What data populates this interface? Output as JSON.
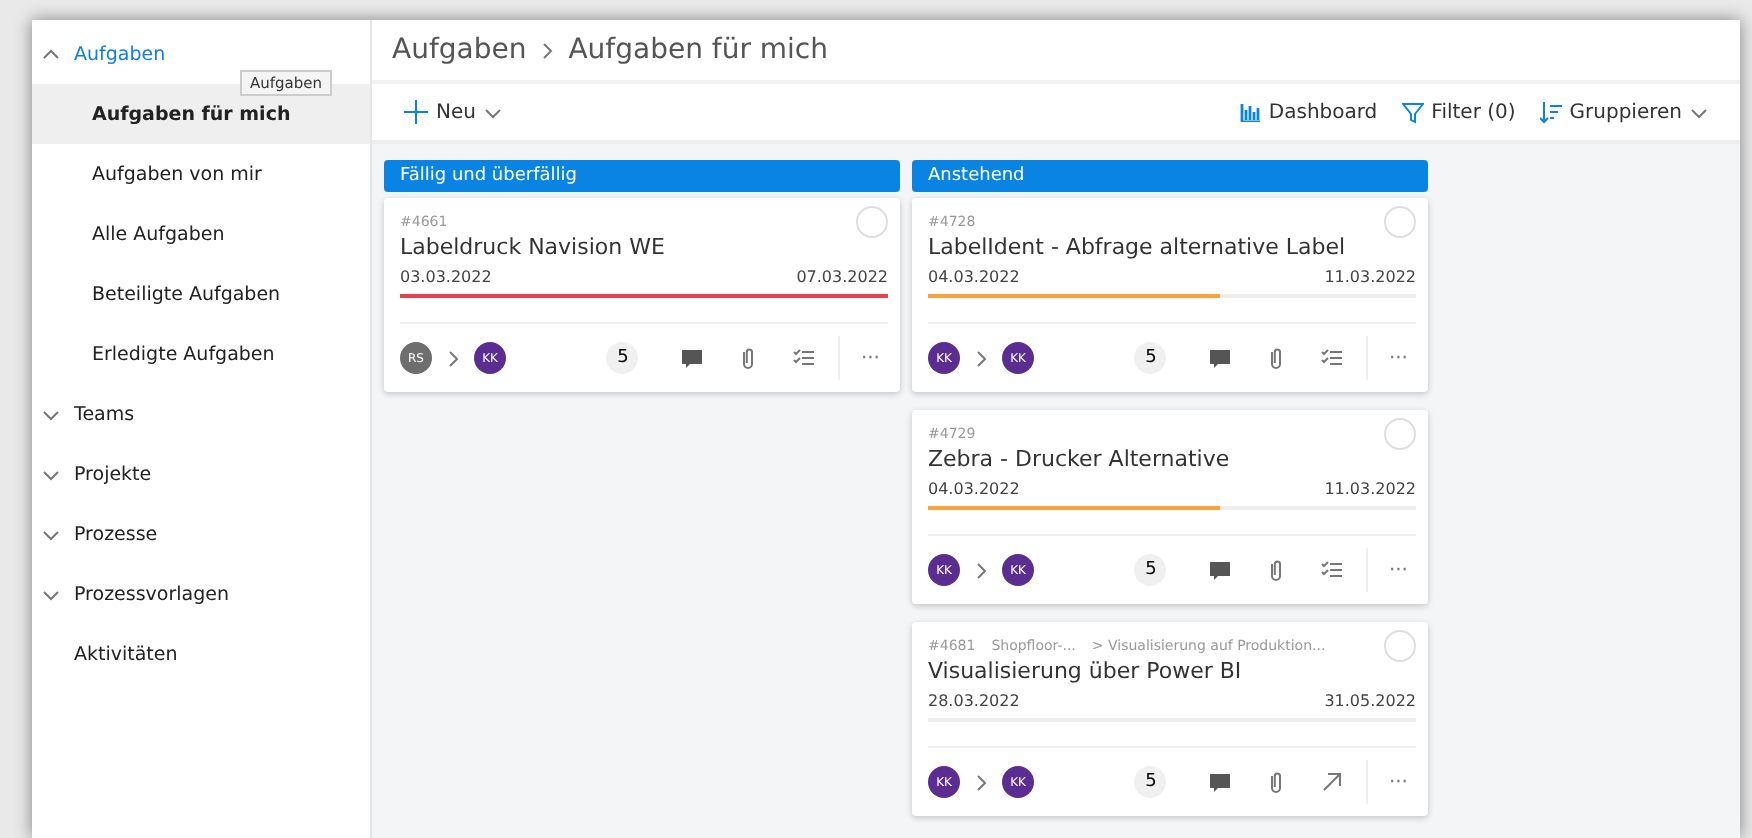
{
  "sidebar": {
    "items": [
      {
        "label": "Aufgaben",
        "expanded": true,
        "selected": false,
        "tooltip": "Aufgaben",
        "children": [
          {
            "label": "Aufgaben für mich",
            "selected": true
          },
          {
            "label": "Aufgaben von mir",
            "selected": false
          },
          {
            "label": "Alle Aufgaben",
            "selected": false
          },
          {
            "label": "Beteiligte Aufgaben",
            "selected": false
          },
          {
            "label": "Erledigte Aufgaben",
            "selected": false
          }
        ]
      },
      {
        "label": "Teams",
        "expanded": false,
        "selected": false
      },
      {
        "label": "Projekte",
        "expanded": false,
        "selected": false
      },
      {
        "label": "Prozesse",
        "expanded": false,
        "selected": false
      },
      {
        "label": "Prozessvorlagen",
        "expanded": false,
        "selected": false
      },
      {
        "label": "Aktivitäten",
        "selected": false
      }
    ]
  },
  "breadcrumb": [
    "Aufgaben",
    "Aufgaben für mich"
  ],
  "toolbar": {
    "new_label": "Neu",
    "dashboard": "Dashboard",
    "filter": "Filter (0)",
    "group": "Gruppieren"
  },
  "columns": [
    {
      "title": "Fällig und überfällig",
      "cards": [
        {
          "number": "#4661",
          "title": "Labeldruck Navision WE",
          "start": "03.03.2022",
          "end": "07.03.2022",
          "level": 1,
          "color": "#e8404c",
          "from": {
            "initials": "RS",
            "color": "#6e6e6e"
          },
          "to": {
            "initials": "KK",
            "color": "#5c2d91"
          },
          "count": "5",
          "kind": "checklist",
          "done": false,
          "more": "···"
        }
      ]
    },
    {
      "title": "Anstehend",
      "cards": [
        {
          "number": "#4728",
          "title": "LabelIdent - Abfrage alternative Label",
          "start": "04.03.2022",
          "end": "11.03.2022",
          "level": 0.6,
          "color": "#f7a53b",
          "from": {
            "initials": "KK",
            "color": "#5c2d91"
          },
          "to": {
            "initials": "KK",
            "color": "#5c2d91"
          },
          "count": "5",
          "kind": "checklist",
          "done": false,
          "more": "···"
        },
        {
          "number": "#4729",
          "title": "Zebra - Drucker Alternative",
          "start": "04.03.2022",
          "end": "11.03.2022",
          "level": 0.6,
          "color": "#f7a53b",
          "from": {
            "initials": "KK",
            "color": "#5c2d91"
          },
          "to": {
            "initials": "KK",
            "color": "#5c2d91"
          },
          "count": "5",
          "kind": "checklist",
          "done": false,
          "more": "···"
        },
        {
          "number": "#4681",
          "path": [
            "Shopfloor-...",
            "> Visualisierung auf Produktion..."
          ],
          "title": "Visualisierung über Power BI",
          "start": "28.03.2022",
          "end": "31.05.2022",
          "from": {
            "initials": "KK",
            "color": "#5c2d91"
          },
          "to": {
            "initials": "KK",
            "color": "#5c2d91"
          },
          "count": "5",
          "kind": "subtask",
          "done": false,
          "more": "···"
        }
      ]
    }
  ]
}
